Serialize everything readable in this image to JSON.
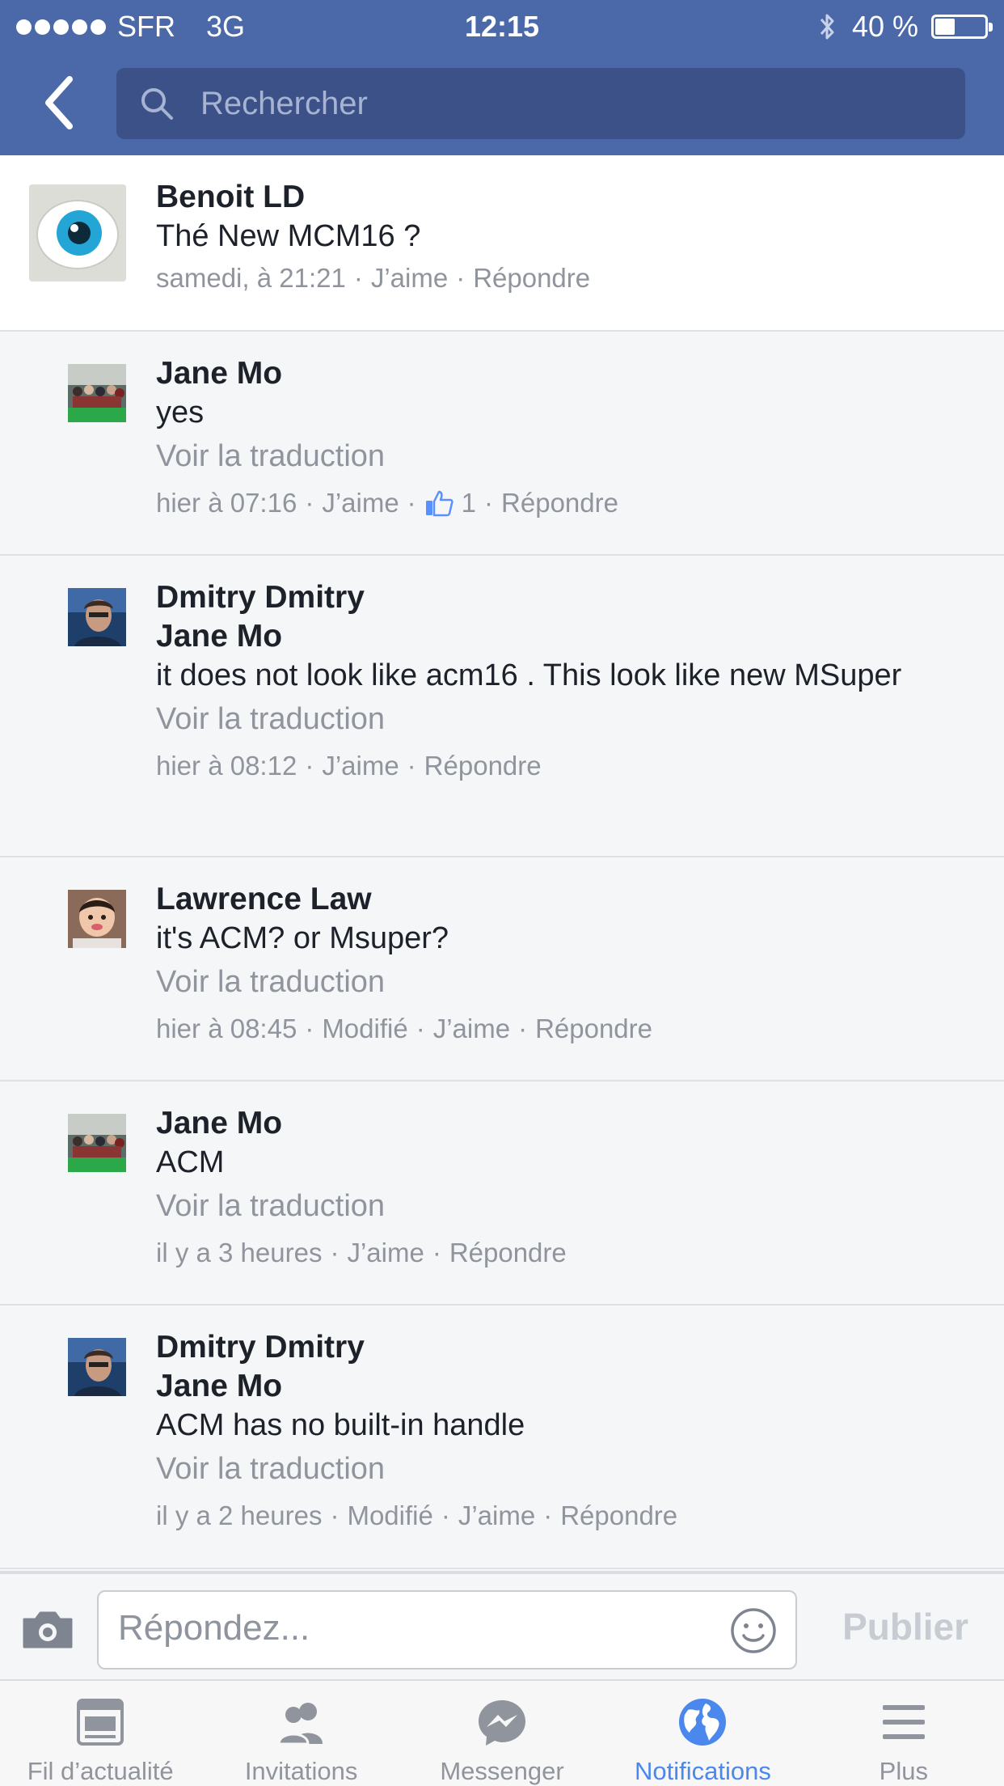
{
  "status_bar": {
    "carrier": "SFR",
    "network": "3G",
    "time": "12:15",
    "battery": "40 %",
    "battery_level": 0.4
  },
  "search": {
    "placeholder": "Rechercher"
  },
  "comments": [
    {
      "name": "Benoit LD",
      "mention": "",
      "text": "Thé New MCM16 ?",
      "translate": "",
      "time": "samedi, à 21:21",
      "edited": "",
      "like": "J’aime",
      "likes_count": "",
      "reply": "Répondre"
    },
    {
      "name": "Jane Mo",
      "mention": "",
      "text": "yes",
      "translate": "Voir la traduction",
      "time": "hier à 07:16",
      "edited": "",
      "like": "J’aime",
      "likes_count": "1",
      "reply": "Répondre"
    },
    {
      "name": "Dmitry Dmitry",
      "mention": "Jane Mo",
      "text": "it does not look like acm16 . This look like new MSuper",
      "translate": "Voir la traduction",
      "time": "hier à 08:12",
      "edited": "",
      "like": "J’aime",
      "likes_count": "",
      "reply": "Répondre"
    },
    {
      "name": "Lawrence Law",
      "mention": "",
      "text": "it's ACM? or Msuper?",
      "translate": "Voir la traduction",
      "time": "hier à 08:45",
      "edited": "Modifié",
      "like": "J’aime",
      "likes_count": "",
      "reply": "Répondre"
    },
    {
      "name": "Jane Mo",
      "mention": "",
      "text": "ACM",
      "translate": "Voir la traduction",
      "time": "il y a 3 heures",
      "edited": "",
      "like": "J’aime",
      "likes_count": "",
      "reply": "Répondre"
    },
    {
      "name": "Dmitry Dmitry",
      "mention": "Jane Mo",
      "text": "ACM has no built-in handle",
      "translate": "Voir la traduction",
      "time": "il y a 2 heures",
      "edited": "Modifié",
      "like": "J’aime",
      "likes_count": "",
      "reply": "Répondre"
    }
  ],
  "reply_bar": {
    "placeholder": "Répondez...",
    "publish_label": "Publier"
  },
  "tabs": [
    {
      "label": "Fil d’actualité",
      "icon": "news-feed-icon",
      "active": false
    },
    {
      "label": "Invitations",
      "icon": "friends-icon",
      "active": false
    },
    {
      "label": "Messenger",
      "icon": "messenger-icon",
      "active": false
    },
    {
      "label": "Notifications",
      "icon": "globe-icon",
      "active": true
    },
    {
      "label": "Plus",
      "icon": "menu-icon",
      "active": false
    }
  ],
  "colors": {
    "header": "#4b69a8",
    "search_bg": "#3b5187",
    "active_tab": "#4a88ee",
    "meta_gray": "#90949c"
  }
}
